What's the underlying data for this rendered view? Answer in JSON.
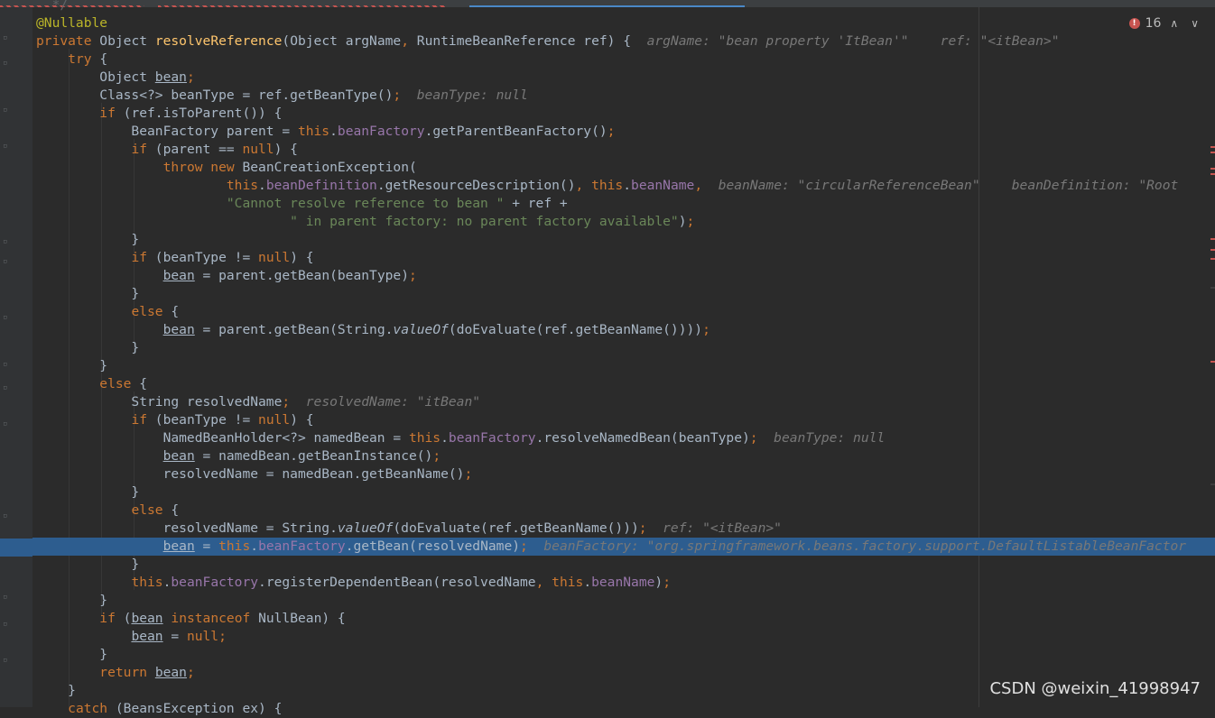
{
  "problems": {
    "error_count": "16",
    "up": "∧",
    "down": "∨"
  },
  "code_lines": [
    {
      "segments": [
        {
          "t": "  */",
          "c": "dec"
        }
      ]
    },
    {
      "segments": [
        {
          "t": "@Nullable",
          "c": "an"
        }
      ]
    },
    {
      "segments": [
        {
          "t": "private ",
          "c": "kw"
        },
        {
          "t": "Object "
        },
        {
          "t": "resolveReference",
          "c": "fn"
        },
        {
          "t": "(Object argName"
        },
        {
          "t": ", ",
          "c": "kw"
        },
        {
          "t": "RuntimeBeanReference ref) {  "
        },
        {
          "t": "argName: \"bean property 'ItBean'\"    ref: \"<itBean>\"",
          "c": "hint"
        }
      ]
    },
    {
      "segments": [
        {
          "t": "    "
        },
        {
          "t": "try ",
          "c": "kw"
        },
        {
          "t": "{"
        }
      ]
    },
    {
      "segments": [
        {
          "t": "        Object "
        },
        {
          "t": "bean",
          "c": "un"
        },
        {
          "t": ";",
          "c": "kw"
        }
      ]
    },
    {
      "segments": [
        {
          "t": "        Class<?> beanType = ref.getBeanType()"
        },
        {
          "t": ";",
          "c": "kw"
        },
        {
          "t": "  "
        },
        {
          "t": "beanType: null",
          "c": "hint"
        }
      ]
    },
    {
      "segments": [
        {
          "t": "        "
        },
        {
          "t": "if ",
          "c": "kw"
        },
        {
          "t": "(ref.isToParent()) {"
        }
      ]
    },
    {
      "segments": [
        {
          "t": "            BeanFactory parent = "
        },
        {
          "t": "this",
          "c": "kw"
        },
        {
          "t": "."
        },
        {
          "t": "beanFactory",
          "c": "fld"
        },
        {
          "t": ".getParentBeanFactory()"
        },
        {
          "t": ";",
          "c": "kw"
        }
      ]
    },
    {
      "segments": [
        {
          "t": "            "
        },
        {
          "t": "if ",
          "c": "kw"
        },
        {
          "t": "(parent == "
        },
        {
          "t": "null",
          "c": "kw"
        },
        {
          "t": ") {"
        }
      ]
    },
    {
      "segments": [
        {
          "t": "                "
        },
        {
          "t": "throw new ",
          "c": "kw"
        },
        {
          "t": "BeanCreationException("
        }
      ]
    },
    {
      "segments": [
        {
          "t": "                        "
        },
        {
          "t": "this",
          "c": "kw"
        },
        {
          "t": "."
        },
        {
          "t": "beanDefinition",
          "c": "fld"
        },
        {
          "t": ".getResourceDescription()"
        },
        {
          "t": ", ",
          "c": "kw"
        },
        {
          "t": "this",
          "c": "kw"
        },
        {
          "t": "."
        },
        {
          "t": "beanName",
          "c": "fld"
        },
        {
          "t": ",  ",
          "c": "kw"
        },
        {
          "t": "beanName: \"circularReferenceBean\"    beanDefinition: \"Root",
          "c": "hint"
        }
      ]
    },
    {
      "segments": [
        {
          "t": "                        "
        },
        {
          "t": "\"Cannot resolve reference to bean \"",
          "c": "str"
        },
        {
          "t": " + ref +"
        }
      ]
    },
    {
      "segments": [
        {
          "t": "                                "
        },
        {
          "t": "\" in parent factory: no parent factory available\"",
          "c": "str"
        },
        {
          "t": ")"
        },
        {
          "t": ";",
          "c": "kw"
        }
      ]
    },
    {
      "segments": [
        {
          "t": "            }"
        }
      ]
    },
    {
      "segments": [
        {
          "t": "            "
        },
        {
          "t": "if ",
          "c": "kw"
        },
        {
          "t": "(beanType != "
        },
        {
          "t": "null",
          "c": "kw"
        },
        {
          "t": ") {"
        }
      ]
    },
    {
      "segments": [
        {
          "t": "                "
        },
        {
          "t": "bean",
          "c": "un"
        },
        {
          "t": " = parent.getBean(beanType)"
        },
        {
          "t": ";",
          "c": "kw"
        }
      ]
    },
    {
      "segments": [
        {
          "t": "            }"
        }
      ]
    },
    {
      "segments": [
        {
          "t": "            "
        },
        {
          "t": "else ",
          "c": "kw"
        },
        {
          "t": "{"
        }
      ]
    },
    {
      "segments": [
        {
          "t": "                "
        },
        {
          "t": "bean",
          "c": "un"
        },
        {
          "t": " = parent.getBean(String."
        },
        {
          "t": "valueOf",
          "c": "st"
        },
        {
          "t": "(doEvaluate(ref.getBeanName())))"
        },
        {
          "t": ";",
          "c": "kw"
        }
      ]
    },
    {
      "segments": [
        {
          "t": "            }"
        }
      ]
    },
    {
      "segments": [
        {
          "t": "        }"
        }
      ]
    },
    {
      "segments": [
        {
          "t": "        "
        },
        {
          "t": "else ",
          "c": "kw"
        },
        {
          "t": "{"
        }
      ]
    },
    {
      "segments": [
        {
          "t": "            String resolvedName"
        },
        {
          "t": ";",
          "c": "kw"
        },
        {
          "t": "  "
        },
        {
          "t": "resolvedName: \"itBean\"",
          "c": "hint"
        }
      ]
    },
    {
      "segments": [
        {
          "t": "            "
        },
        {
          "t": "if ",
          "c": "kw"
        },
        {
          "t": "(beanType != "
        },
        {
          "t": "null",
          "c": "kw"
        },
        {
          "t": ") {"
        }
      ]
    },
    {
      "segments": [
        {
          "t": "                NamedBeanHolder<?> namedBean = "
        },
        {
          "t": "this",
          "c": "kw"
        },
        {
          "t": "."
        },
        {
          "t": "beanFactory",
          "c": "fld"
        },
        {
          "t": ".resolveNamedBean(beanType)"
        },
        {
          "t": ";",
          "c": "kw"
        },
        {
          "t": "  "
        },
        {
          "t": "beanType: null",
          "c": "hint"
        }
      ]
    },
    {
      "segments": [
        {
          "t": "                "
        },
        {
          "t": "bean",
          "c": "un"
        },
        {
          "t": " = namedBean.getBeanInstance()"
        },
        {
          "t": ";",
          "c": "kw"
        }
      ]
    },
    {
      "segments": [
        {
          "t": "                resolvedName = namedBean.getBeanName()"
        },
        {
          "t": ";",
          "c": "kw"
        }
      ]
    },
    {
      "segments": [
        {
          "t": "            }"
        }
      ]
    },
    {
      "segments": [
        {
          "t": "            "
        },
        {
          "t": "else ",
          "c": "kw"
        },
        {
          "t": "{"
        }
      ]
    },
    {
      "segments": [
        {
          "t": "                resolvedName = String."
        },
        {
          "t": "valueOf",
          "c": "st"
        },
        {
          "t": "(doEvaluate(ref.getBeanName()))"
        },
        {
          "t": ";",
          "c": "kw"
        },
        {
          "t": "  "
        },
        {
          "t": "ref: \"<itBean>\"",
          "c": "hint"
        }
      ]
    },
    {
      "highlight": true,
      "segments": [
        {
          "t": "                "
        },
        {
          "t": "bean",
          "c": "un"
        },
        {
          "t": " = "
        },
        {
          "t": "this",
          "c": "kw"
        },
        {
          "t": "."
        },
        {
          "t": "beanFactory",
          "c": "fld"
        },
        {
          "t": ".getBean(resolvedName)"
        },
        {
          "t": ";",
          "c": "kw"
        },
        {
          "t": "  "
        },
        {
          "t": "beanFactory: \"org.springframework.beans.factory.support.DefaultListableBeanFactor",
          "c": "hint"
        }
      ]
    },
    {
      "segments": [
        {
          "t": "            }"
        }
      ]
    },
    {
      "segments": [
        {
          "t": "            "
        },
        {
          "t": "this",
          "c": "kw"
        },
        {
          "t": "."
        },
        {
          "t": "beanFactory",
          "c": "fld"
        },
        {
          "t": ".registerDependentBean(resolvedName"
        },
        {
          "t": ", ",
          "c": "kw"
        },
        {
          "t": "this",
          "c": "kw"
        },
        {
          "t": "."
        },
        {
          "t": "beanName",
          "c": "fld"
        },
        {
          "t": ")"
        },
        {
          "t": ";",
          "c": "kw"
        }
      ]
    },
    {
      "segments": [
        {
          "t": "        }"
        }
      ]
    },
    {
      "segments": [
        {
          "t": "        "
        },
        {
          "t": "if ",
          "c": "kw"
        },
        {
          "t": "("
        },
        {
          "t": "bean",
          "c": "un"
        },
        {
          "t": " "
        },
        {
          "t": "instanceof ",
          "c": "kw"
        },
        {
          "t": "NullBean) {"
        }
      ]
    },
    {
      "segments": [
        {
          "t": "            "
        },
        {
          "t": "bean",
          "c": "un"
        },
        {
          "t": " = "
        },
        {
          "t": "null",
          "c": "kw"
        },
        {
          "t": ";",
          "c": "kw"
        }
      ]
    },
    {
      "segments": [
        {
          "t": "        }"
        }
      ]
    },
    {
      "segments": [
        {
          "t": "        "
        },
        {
          "t": "return ",
          "c": "kw"
        },
        {
          "t": "bean",
          "c": "un"
        },
        {
          "t": ";",
          "c": "kw"
        }
      ]
    },
    {
      "segments": [
        {
          "t": "    }"
        }
      ]
    },
    {
      "segments": [
        {
          "t": "    "
        },
        {
          "t": "catch ",
          "c": "kw"
        },
        {
          "t": "(BeansException ex) {"
        }
      ]
    }
  ],
  "watermark": "CSDN @weixin_41998947"
}
